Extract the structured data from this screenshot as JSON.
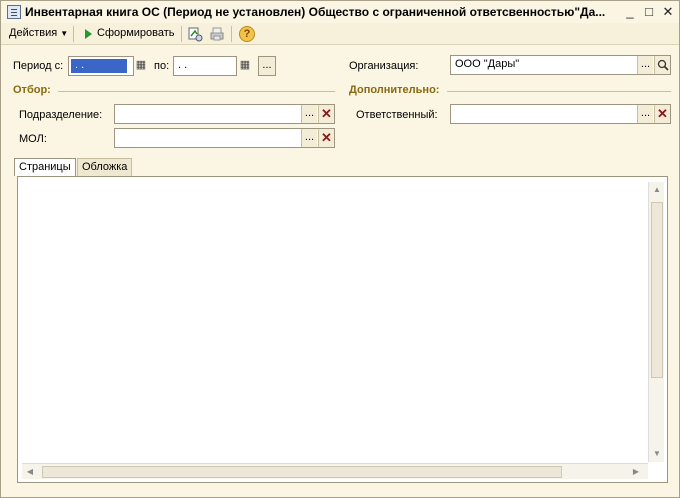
{
  "window": {
    "title": "Инвентарная книга ОС (Период не установлен) Общество с ограниченной ответсвенностью\"Да...",
    "controls": {
      "minimize": "_",
      "maximize": "□",
      "close": "✕"
    }
  },
  "toolbar": {
    "actions_label": "Действия",
    "generate_label": "Сформировать",
    "help_label": "?"
  },
  "period": {
    "from_label": "Период с:",
    "from_value": ". .",
    "to_label": "по:",
    "to_value": ". .",
    "more_label": "..."
  },
  "organization": {
    "label": "Организация:",
    "value": "ООО \"Дары\""
  },
  "filter": {
    "title": "Отбор:",
    "subdivision_label": "Подразделение:",
    "subdivision_value": "",
    "mol_label": "МОЛ:",
    "mol_value": ""
  },
  "additional": {
    "title": "Дополнительно:",
    "responsible_label": "Ответственный:",
    "responsible_value": ""
  },
  "tabs": [
    {
      "label": "Страницы",
      "active": true
    },
    {
      "label": "Обложка",
      "active": false
    }
  ],
  "icons": {
    "calendar": "calendar-icon",
    "search": "search-icon",
    "clear": "clear-icon",
    "select": "ellipsis-icon",
    "help": "help-icon",
    "generate": "play-icon"
  },
  "colors": {
    "window_bg": "#fbf5e3",
    "section_title": "#8a6a10",
    "selection": "#3b66c7"
  }
}
